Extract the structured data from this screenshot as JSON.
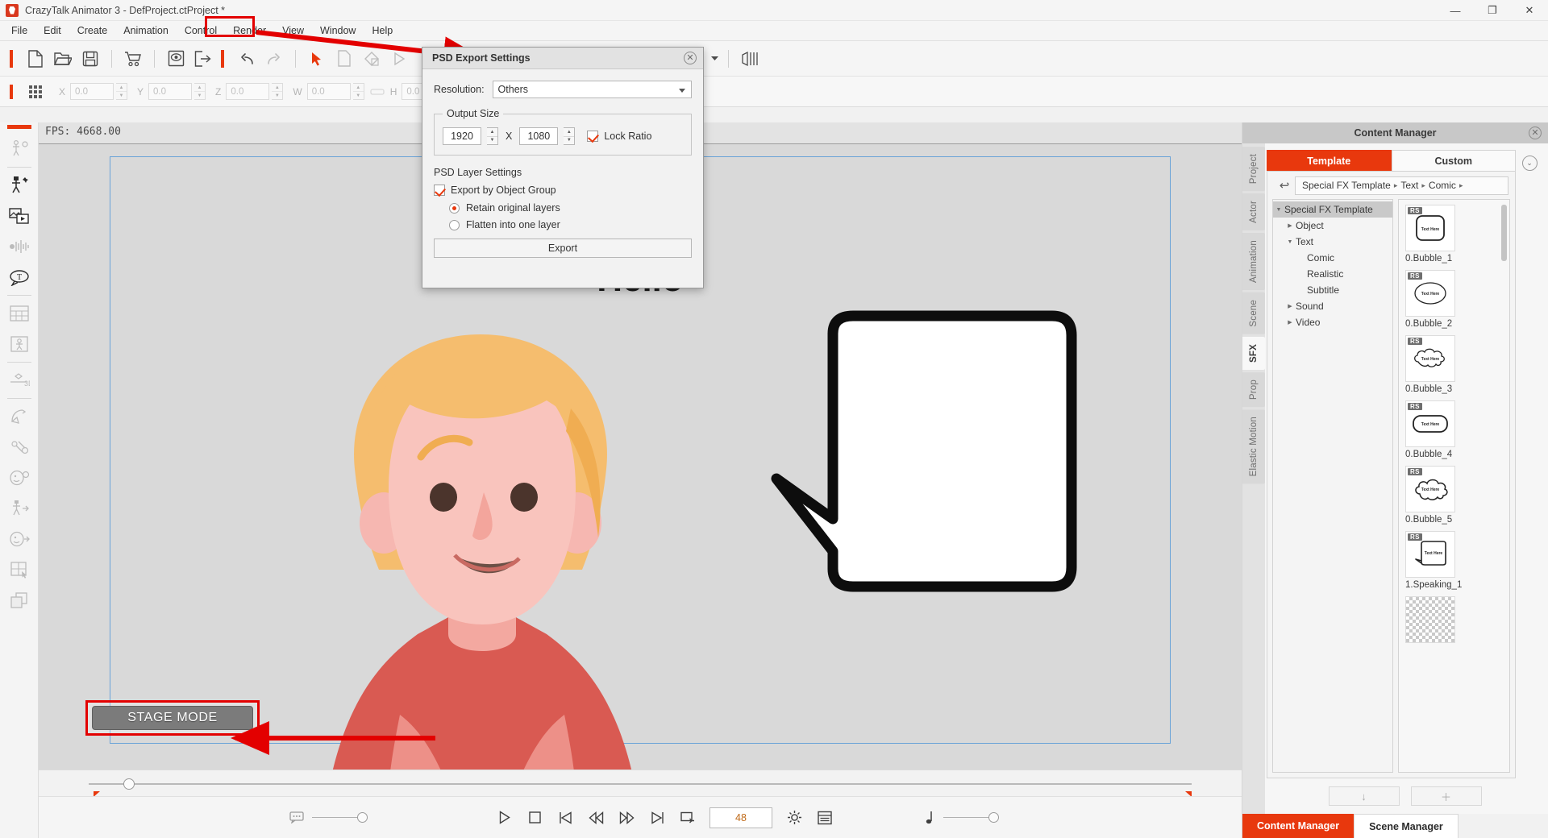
{
  "titlebar": {
    "app_name": "CrazyTalk Animator 3",
    "document": " - DefProject.ctProject *",
    "minimize": "—",
    "maximize": "❐",
    "close": "✕"
  },
  "menubar": {
    "items": [
      {
        "label": "File"
      },
      {
        "label": "Edit"
      },
      {
        "label": "Create"
      },
      {
        "label": "Animation"
      },
      {
        "label": "Control"
      },
      {
        "label": "Render"
      },
      {
        "label": "View"
      },
      {
        "label": "Window"
      },
      {
        "label": "Help"
      }
    ],
    "highlighted": "Render"
  },
  "toolbar": {
    "buttons": [
      {
        "name": "new-project-icon"
      },
      {
        "name": "open-project-icon"
      },
      {
        "name": "save-project-icon"
      },
      {
        "name": "marketplace-cart-icon"
      },
      {
        "name": "preview-eye-icon"
      },
      {
        "name": "export-icon"
      },
      {
        "name": "undo-icon"
      },
      {
        "name": "redo-icon"
      },
      {
        "name": "select-arrow-icon"
      },
      {
        "name": "page-icon"
      },
      {
        "name": "paint-bucket-icon"
      },
      {
        "name": "play-triangle-icon"
      },
      {
        "name": "move-icon"
      },
      {
        "name": "rotate-icon"
      },
      {
        "name": "cube-3d-icon"
      },
      {
        "name": "mirror-icon"
      }
    ]
  },
  "transform_bar": {
    "grid_icon": "grid-icon",
    "fields": [
      {
        "label": "X",
        "value": "0.0"
      },
      {
        "label": "Y",
        "value": "0.0"
      },
      {
        "label": "Z",
        "value": "0.0"
      },
      {
        "label": "W",
        "value": "0.0"
      },
      {
        "label": "H",
        "value": "0.0"
      }
    ],
    "link_icon": "link-ratio-icon"
  },
  "left_rail": {
    "items": [
      {
        "name": "actor-settings-icon",
        "dim": true
      },
      {
        "name": "create-actor-icon",
        "dim": false
      },
      {
        "name": "media-prop-icon",
        "dim": false
      },
      {
        "name": "audio-waveform-icon",
        "dim": true
      },
      {
        "name": "text-bubble-icon",
        "dim": false
      },
      {
        "name": "sprite-sheet-icon",
        "dim": true
      },
      {
        "name": "scene-frame-icon",
        "dim": true
      },
      {
        "name": "three-d-icon",
        "dim": true
      },
      {
        "name": "elastic-motion-icon",
        "dim": true
      },
      {
        "name": "motion-puppet-icon",
        "dim": true
      },
      {
        "name": "face-puppet-icon",
        "dim": true
      },
      {
        "name": "body-motion-icon",
        "dim": true
      },
      {
        "name": "face-key-icon",
        "dim": true
      },
      {
        "name": "transform-grid-icon",
        "dim": true
      },
      {
        "name": "layer-order-icon",
        "dim": true
      }
    ]
  },
  "viewport": {
    "fps_label": "FPS: 4668.00",
    "stage_mode_button": "STAGE MODE",
    "bubble_text": "Hello"
  },
  "transport": {
    "comment_slider_icon": "comment-icon",
    "buttons": [
      {
        "name": "play-button",
        "glyph": "▷"
      },
      {
        "name": "stop-button",
        "glyph": "□"
      },
      {
        "name": "first-frame-button",
        "glyph": "⏮"
      },
      {
        "name": "prev-frame-button",
        "glyph": "⏪"
      },
      {
        "name": "next-frame-button",
        "glyph": "⏩"
      },
      {
        "name": "last-frame-button",
        "glyph": "⏭"
      },
      {
        "name": "loop-button",
        "glyph": "↴"
      }
    ],
    "frame_value": "48",
    "settings_icon": "gear-icon",
    "timeline-icon": "timeline-list-icon",
    "audio_icon": "music-note-icon"
  },
  "psd_dialog": {
    "title": "PSD Export Settings",
    "close_glyph": "✕",
    "resolution_label": "Resolution:",
    "resolution_value": "Others",
    "output_size_legend": "Output Size",
    "width": "1920",
    "height": "1080",
    "x_separator": "X",
    "lock_ratio_label": "Lock Ratio",
    "lock_ratio_checked": true,
    "layer_settings_label": "PSD Layer Settings",
    "export_by_group_label": "Export by Object Group",
    "export_by_group_checked": true,
    "options": [
      {
        "label": "Retain original layers",
        "selected": true
      },
      {
        "label": "Flatten into one layer",
        "selected": false
      }
    ],
    "export_button": "Export"
  },
  "content_manager": {
    "header_title": "Content Manager",
    "close_glyph": "✕",
    "vertical_tabs": [
      {
        "label": "Project",
        "active": false
      },
      {
        "label": "Actor",
        "active": false
      },
      {
        "label": "Animation",
        "active": false
      },
      {
        "label": "Scene",
        "active": false
      },
      {
        "label": "SFX",
        "active": true
      },
      {
        "label": "Prop",
        "active": false
      },
      {
        "label": "Elastic Motion",
        "active": false
      }
    ],
    "tabs": [
      {
        "label": "Template",
        "active": true
      },
      {
        "label": "Custom",
        "active": false
      }
    ],
    "expand_glyph": "⌄",
    "back_glyph": "↩",
    "breadcrumb": [
      {
        "label": "Special FX Template"
      },
      {
        "label": "Text"
      },
      {
        "label": "Comic"
      }
    ],
    "crumb_sep": "▸",
    "tree": [
      {
        "label": "Special FX Template",
        "depth": 0,
        "tri": "▼",
        "selected": true
      },
      {
        "label": "Object",
        "depth": 1,
        "tri": "▶",
        "selected": false
      },
      {
        "label": "Text",
        "depth": 1,
        "tri": "▼",
        "selected": false
      },
      {
        "label": "Comic",
        "depth": 2,
        "tri": "",
        "selected": false
      },
      {
        "label": "Realistic",
        "depth": 2,
        "tri": "",
        "selected": false
      },
      {
        "label": "Subtitle",
        "depth": 2,
        "tri": "",
        "selected": false
      },
      {
        "label": "Sound",
        "depth": 1,
        "tri": "▶",
        "selected": false
      },
      {
        "label": "Video",
        "depth": 1,
        "tri": "▶",
        "selected": false
      }
    ],
    "assets": [
      {
        "label": "0.Bubble_1",
        "badge": "RS",
        "shape": "rounded-rect"
      },
      {
        "label": "0.Bubble_2",
        "badge": "RS",
        "shape": "ellipse"
      },
      {
        "label": "0.Bubble_3",
        "badge": "RS",
        "shape": "cloud"
      },
      {
        "label": "0.Bubble_4",
        "badge": "RS",
        "shape": "pill"
      },
      {
        "label": "0.Bubble_5",
        "badge": "RS",
        "shape": "cloud2"
      },
      {
        "label": "1.Speaking_1",
        "badge": "RS",
        "shape": "speech"
      },
      {
        "label": "",
        "badge": "",
        "shape": "checker"
      }
    ],
    "thumb_text": "Text Here",
    "footer_buttons": [
      {
        "name": "download-button",
        "glyph": "↓"
      },
      {
        "name": "add-button",
        "glyph": "＋"
      }
    ],
    "bottom_tabs": [
      {
        "label": "Content Manager",
        "active": true
      },
      {
        "label": "Scene Manager",
        "active": false
      }
    ]
  },
  "colors": {
    "accent": "#e8380d",
    "annotation": "#e30000",
    "panel_bg": "#f2f2f2",
    "viewport_bg": "#d9d9d9"
  }
}
